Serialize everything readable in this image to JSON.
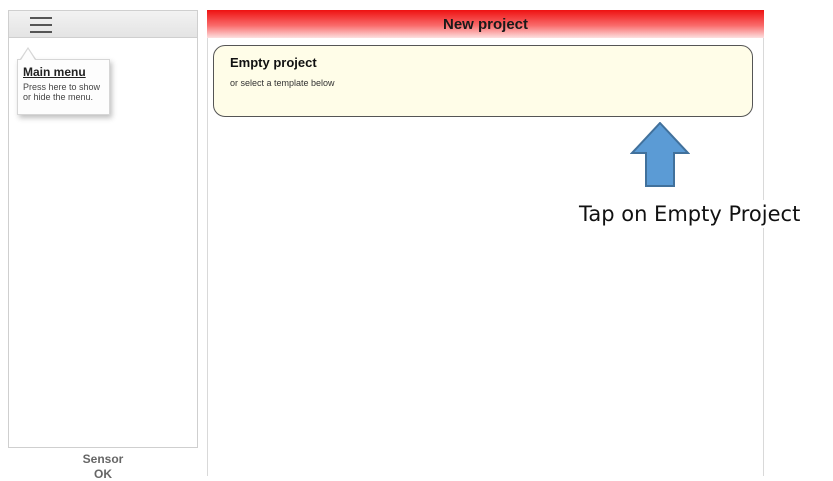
{
  "sidebar": {
    "menu_icon": "hamburger-menu-icon",
    "tooltip": {
      "title": "Main menu",
      "text": "Press here to show\nor hide the menu."
    },
    "sensor_label": "Sensor",
    "sensor_status": "OK"
  },
  "main": {
    "title": "New project",
    "empty_project": {
      "title": "Empty project",
      "subtitle": "or select a template below"
    }
  },
  "annotation": {
    "arrow_icon": "up-arrow-icon",
    "text": "Tap on Empty Project",
    "arrow_color": "#5b9bd5"
  },
  "colors": {
    "header_red": "#ee1111",
    "card_background": "#fffde8"
  }
}
